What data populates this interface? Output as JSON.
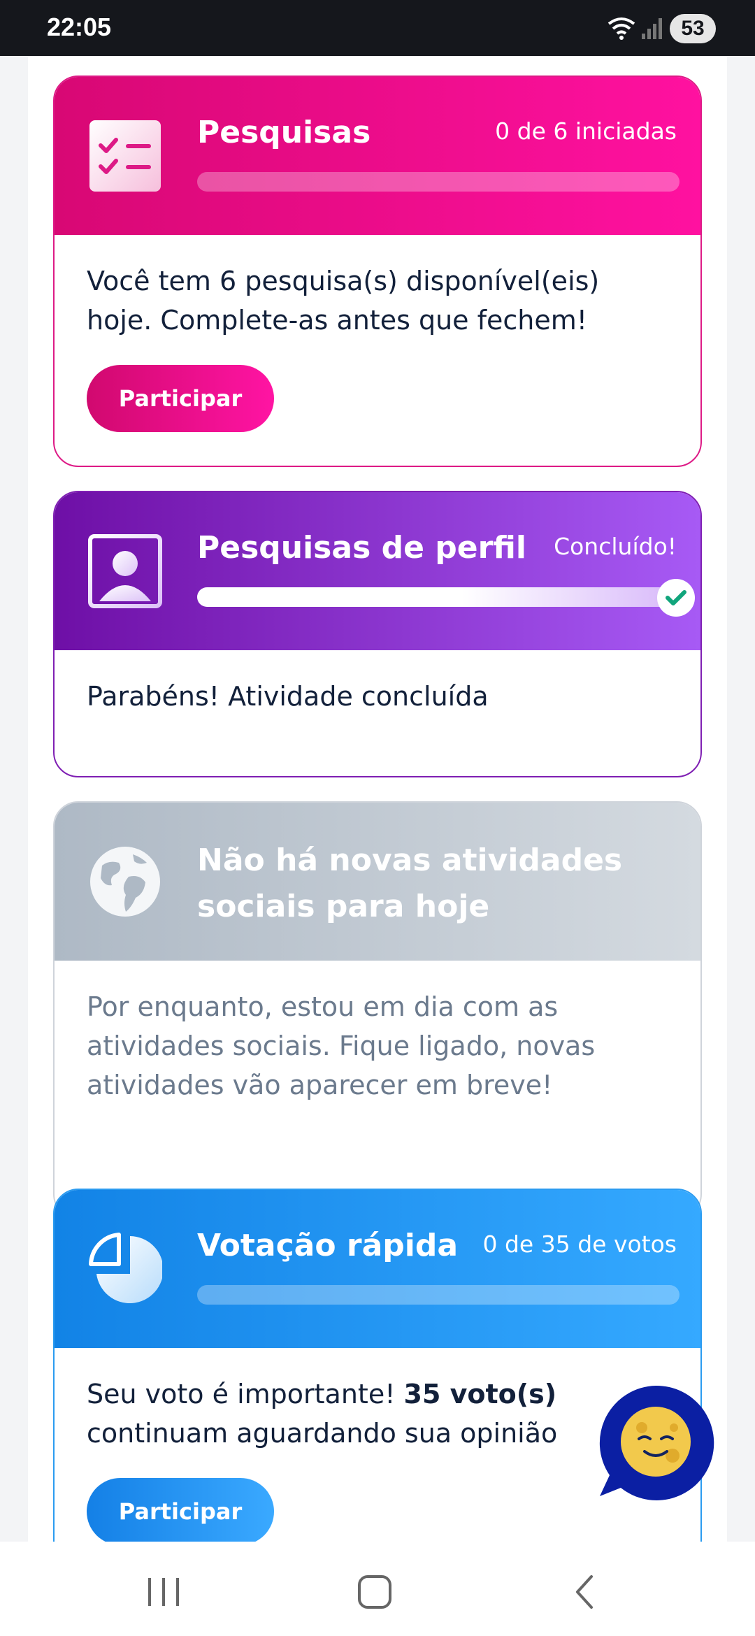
{
  "status_bar": {
    "time": "22:05",
    "battery": "53",
    "icons": [
      "wifi-icon",
      "signal-icon"
    ]
  },
  "cards": {
    "surveys": {
      "title": "Pesquisas",
      "status": "0 de 6 iniciadas",
      "progress": 0,
      "body": "Você tem 6 pesquisa(s) disponível(eis) hoje. Complete-as antes que fechem!",
      "button": "Participar",
      "icon": "checklist-icon",
      "color": "#dd1a86"
    },
    "profile": {
      "title": "Pesquisas de perfil",
      "status": "Concluído!",
      "progress": 1,
      "body": "Parabéns! Atividade concluída",
      "icon": "profile-picture-icon",
      "color": "#7f1fb3"
    },
    "social": {
      "title": "Não há novas atividades sociais para hoje",
      "body": "Por enquanto, estou em dia com as atividades sociais. Fique ligado, novas atividades vão aparecer em breve!",
      "icon": "globe-icon",
      "color": "#aeb9c5"
    },
    "quick_vote": {
      "title": "Votação rápida",
      "status": "0 de 35 de votos",
      "progress": 0,
      "body_prefix": "Seu voto é importante! ",
      "body_bold": "35 voto(s)",
      "body_suffix": " continuam aguardando sua opinião",
      "button": "Participar",
      "icon": "pie-chart-icon",
      "color": "#1283e6"
    }
  },
  "chat_fab": {
    "icon": "chat-assistant-icon"
  },
  "nav_bar": {
    "icons": [
      "recent-apps-icon",
      "home-icon",
      "back-icon"
    ]
  }
}
